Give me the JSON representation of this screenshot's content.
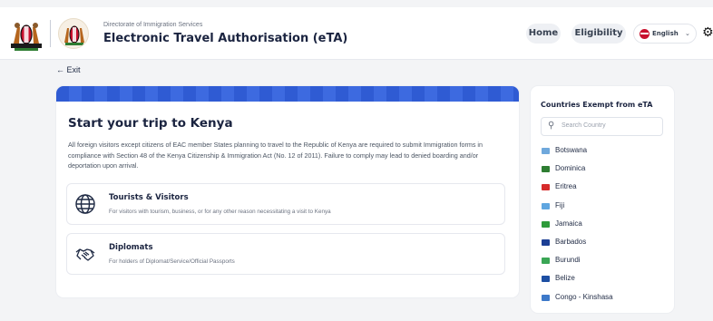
{
  "header": {
    "subtitle": "Directorate of Immigration Services",
    "title": "Electronic Travel Authorisation (eTA)",
    "nav": {
      "home": "Home",
      "eligibility": "Eligibility"
    },
    "language": "English",
    "icons": {
      "coat_of_arms": "kenya-coat-of-arms-icon",
      "department_seal": "immigration-seal-icon",
      "language": "globe-icon",
      "dropdown": "chevron-down-icon",
      "settings": "gear-icon"
    }
  },
  "exit": {
    "arrow": "←",
    "label": "Exit"
  },
  "main": {
    "title": "Start your trip to Kenya",
    "description": "All foreign visitors except citizens of EAC member States planning to travel to the Republic of Kenya are required to submit Immigration forms in compliance with Section 48 of the Kenya Citizenship & Immigration Act (No. 12 of 2011). Failure to comply may lead to denied boarding and/or deportation upon arrival.",
    "options": [
      {
        "title": "Tourists & Visitors",
        "description": "For visitors with tourism, business, or for any other reason necessitating a visit to Kenya",
        "icon": "globe-icon"
      },
      {
        "title": "Diplomats",
        "description": "For holders of Diplomat/Service/Official Passports",
        "icon": "handshake-icon"
      }
    ],
    "accent": "#2f5bd3"
  },
  "exempt": {
    "title": "Countries Exempt from eTA",
    "search_placeholder": "Search Country",
    "countries": [
      {
        "name": "Botswana",
        "flag": "#6fa8dc"
      },
      {
        "name": "Dominica",
        "flag": "#2e7d32"
      },
      {
        "name": "Eritrea",
        "flag": "#d62b2b"
      },
      {
        "name": "Fiji",
        "flag": "#5fa6e0"
      },
      {
        "name": "Jamaica",
        "flag": "#2e9b3a"
      },
      {
        "name": "Barbados",
        "flag": "#1c3f94"
      },
      {
        "name": "Burundi",
        "flag": "#3aa655"
      },
      {
        "name": "Belize",
        "flag": "#1d4fa3"
      },
      {
        "name": "Congo - Kinshasa",
        "flag": "#3d79c9"
      }
    ]
  }
}
